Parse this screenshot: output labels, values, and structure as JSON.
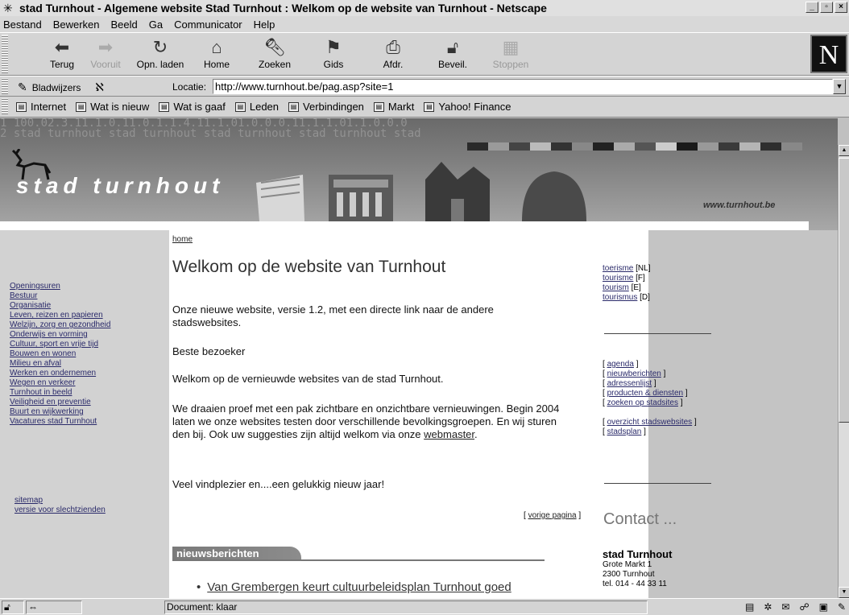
{
  "window": {
    "title": "stad Turnhout - Algemene website Stad Turnhout : Welkom op de website van Turnhout - Netscape"
  },
  "menu": [
    "Bestand",
    "Bewerken",
    "Beeld",
    "Ga",
    "Communicator",
    "Help"
  ],
  "toolbar": {
    "buttons": [
      {
        "label": "Terug",
        "icon": "back-arrow-icon"
      },
      {
        "label": "Vooruit",
        "icon": "forward-arrow-icon"
      },
      {
        "label": "Opn. laden",
        "icon": "reload-icon"
      },
      {
        "label": "Home",
        "icon": "home-icon"
      },
      {
        "label": "Zoeken",
        "icon": "search-icon"
      },
      {
        "label": "Gids",
        "icon": "guide-icon"
      },
      {
        "label": "Afdr.",
        "icon": "print-icon"
      },
      {
        "label": "Beveil.",
        "icon": "security-lock-icon"
      },
      {
        "label": "Stoppen",
        "icon": "stop-icon"
      }
    ],
    "logo": "N"
  },
  "location": {
    "bookmarks_label": "Bladwijzers",
    "label": "Locatie:",
    "url": "http://www.turnhout.be/pag.asp?site=1"
  },
  "personal_toolbar": [
    "Internet",
    "Wat is nieuw",
    "Wat is gaaf",
    "Leden",
    "Verbindingen",
    "Markt",
    "Yahoo! Finance"
  ],
  "banner": {
    "title": "stad turnhout",
    "url": "www.turnhout.be",
    "background_numbers": "1 100.02.3.11.1.0.11.0.1.1.4.11.1.01.0.0.0.11.1.1.01.1.0.0.0\n2 stad turnhout stad turnhout stad turnhout stad turnhout stad"
  },
  "left_nav": {
    "items": [
      "Openingsuren",
      "Bestuur",
      "Organisatie",
      "Leven, reizen en papieren",
      "Welzijn, zorg en gezondheid",
      "Onderwijs en vorming",
      "Cultuur, sport en vrije tijd",
      "Bouwen en wonen",
      "Milieu en afval",
      "Werken en ondernemen",
      "Wegen en verkeer",
      "Turnhout in beeld",
      "Veiligheid en preventie",
      "Buurt en wijkwerking",
      "Vacatures stad Turnhout"
    ],
    "extra": [
      "sitemap",
      "versie voor slechtzienden"
    ]
  },
  "main": {
    "breadcrumb": "home",
    "heading": "Welkom op de website van Turnhout",
    "para1": "Onze nieuwe website, versie 1.2, met een directe link naar de andere stadswebsites.",
    "para2": "Beste bezoeker",
    "para3": "Welkom op de vernieuwde websites van de stad Turnhout.",
    "para4_text": "We draaien proef met een pak zichtbare en onzichtbare vernieuwingen. Begin 2004 laten we onze websites testen door verschillende bevolkingsgroepen. En wij sturen den bij. Ook uw suggesties zijn altijd welkom via onze ",
    "para4_link": "webmaster",
    "para4_end": ".",
    "para5": "Veel vindplezier en....een gelukkig nieuw jaar!",
    "back_link": "vorige pagina",
    "news_heading": "nieuwsberichten",
    "news_items": [
      "Van Grembergen keurt cultuurbeleidsplan Turnhout goed"
    ]
  },
  "right": {
    "tourism": [
      {
        "link": "toerisme",
        "lang": "[NL]"
      },
      {
        "link": "tourisme",
        "lang": "[F]"
      },
      {
        "link": "tourism",
        "lang": "[E]"
      },
      {
        "link": "tourismus",
        "lang": "[D]"
      }
    ],
    "services_a": [
      "agenda",
      "nieuwberichten",
      "adressenlijst",
      "producten & diensten",
      "zoeken op stadsites"
    ],
    "services_b": [
      "overzicht stadswebsites",
      "stadsplan"
    ],
    "contact_heading": "Contact ...",
    "contact": {
      "name": "stad Turnhout",
      "street": "Grote Markt 1",
      "city": "2300 Turnhout",
      "phone": "tel. 014 - 44 33 11"
    }
  },
  "status": {
    "text": "Document: klaar"
  }
}
